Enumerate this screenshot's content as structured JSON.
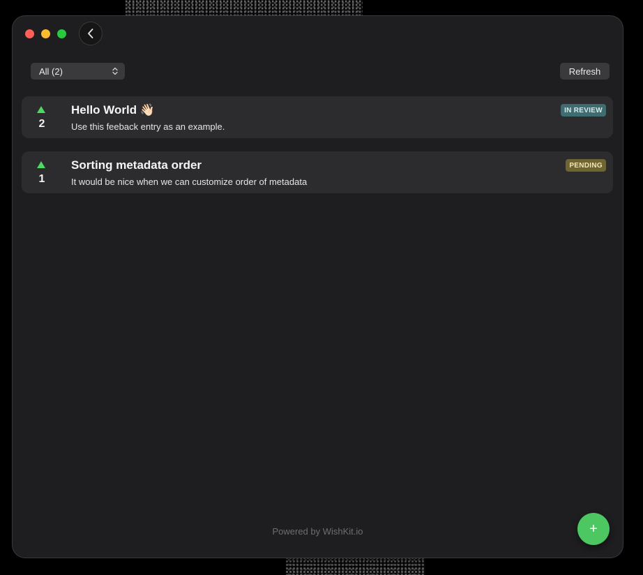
{
  "toolbar": {
    "back_icon": "chevron-left-icon",
    "filter": {
      "selected": "All (2)",
      "icon": "chevron-up-down-icon"
    },
    "refresh_label": "Refresh"
  },
  "feedback": [
    {
      "votes": "2",
      "title": "Hello World 👋🏻",
      "description": "Use this feeback entry as an example.",
      "status": "IN REVIEW",
      "status_color": "#3f6c70"
    },
    {
      "votes": "1",
      "title": "Sorting metadata order",
      "description": "It would be nice when we can customize order of metadata",
      "status": "PENDING",
      "status_color": "#6e6530"
    }
  ],
  "footer": {
    "text": "Powered by WishKit.io"
  },
  "fab": {
    "label": "+",
    "icon": "plus-icon",
    "color": "#4cc761"
  },
  "colors": {
    "window_bg": "#1e1e20",
    "card_bg": "#2c2c2e",
    "upvote_arrow": "#4cd964"
  }
}
